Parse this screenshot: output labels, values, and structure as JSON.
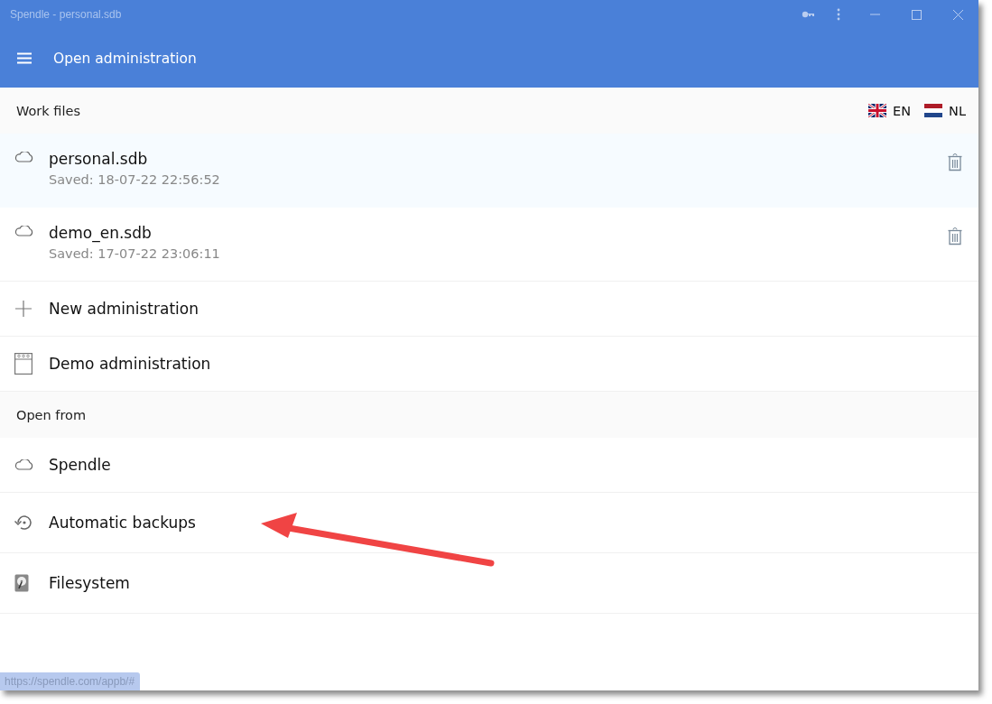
{
  "window": {
    "title": "Spendle - personal.sdb"
  },
  "toolbar": {
    "title": "Open administration"
  },
  "work_files": {
    "heading": "Work files",
    "languages": [
      {
        "code": "EN",
        "kind": "uk"
      },
      {
        "code": "NL",
        "kind": "nl"
      }
    ],
    "files": [
      {
        "name": "personal.sdb",
        "saved": "Saved: 18-07-22 22:56:52",
        "selected": true
      },
      {
        "name": "demo_en.sdb",
        "saved": "Saved: 17-07-22 23:06:11",
        "selected": false
      }
    ],
    "actions": [
      {
        "label": "New administration",
        "kind": "plus"
      },
      {
        "label": "Demo administration",
        "kind": "calendar"
      }
    ]
  },
  "open_from": {
    "heading": "Open from",
    "items": [
      {
        "label": "Spendle",
        "kind": "cloud"
      },
      {
        "label": "Automatic backups",
        "kind": "history"
      },
      {
        "label": "Filesystem",
        "kind": "disk"
      }
    ]
  },
  "status_link": "https://spendle.com/appb/#"
}
